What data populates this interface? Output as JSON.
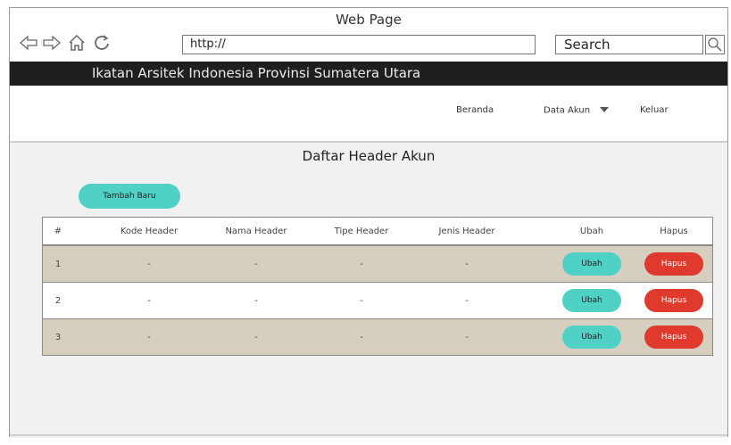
{
  "window": {
    "title": "Web Page"
  },
  "browser": {
    "url": "http://",
    "search_placeholder": "Search"
  },
  "brand": {
    "title": "Ikatan Arsitek Indonesia Provinsi Sumatera Utara"
  },
  "nav": {
    "beranda": "Beranda",
    "data_akun": "Data Akun",
    "keluar": "Keluar"
  },
  "main": {
    "title": "Daftar Header Akun",
    "add_button": "Tambah Baru"
  },
  "table": {
    "headers": [
      "#",
      "Kode Header",
      "Nama Header",
      "Tipe Header",
      "Jenis Header",
      "Ubah",
      "Hapus"
    ],
    "rows": [
      {
        "no": "1",
        "kode": "-",
        "nama": "-",
        "tipe": "-",
        "jenis": "-",
        "ubah": "Ubah",
        "hapus": "Hapus"
      },
      {
        "no": "2",
        "kode": "-",
        "nama": "-",
        "tipe": "-",
        "jenis": "-",
        "ubah": "Ubah",
        "hapus": "Hapus"
      },
      {
        "no": "3",
        "kode": "-",
        "nama": "-",
        "tipe": "-",
        "jenis": "-",
        "ubah": "Ubah",
        "hapus": "Hapus"
      }
    ]
  },
  "icons": {
    "back": "back-arrow-icon",
    "forward": "forward-arrow-icon",
    "home": "home-icon",
    "refresh": "refresh-icon",
    "search": "search-icon",
    "dropdown": "chevron-down-icon"
  },
  "colors": {
    "ubah": "#4fd1c5",
    "hapus": "#e03a2e",
    "brandbar": "#1f1f1f",
    "row_alt": "#d6cfc0"
  }
}
